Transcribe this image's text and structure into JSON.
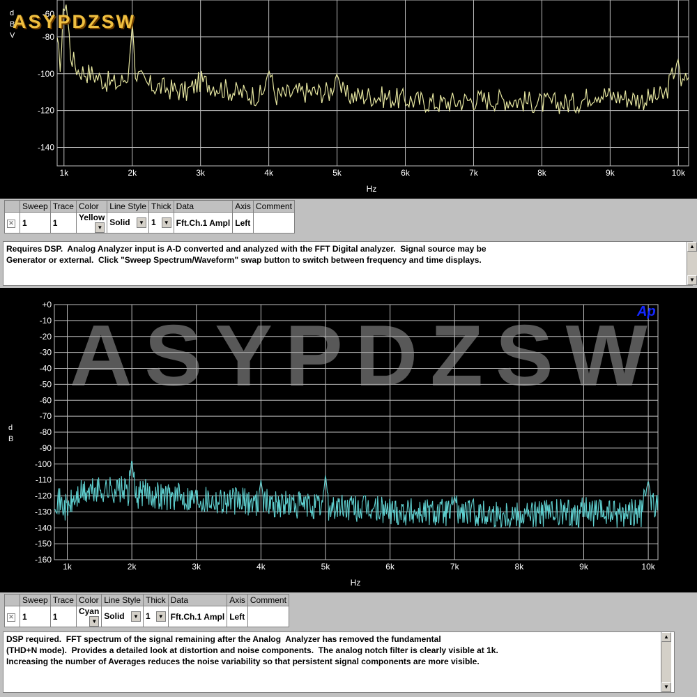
{
  "watermark_logo": "ASYPDZSW",
  "watermark_center": "ASYPDZSW",
  "top_graph": {
    "ylabel": "d\nB\nV",
    "ytick_partial": "-60",
    "yticks": [
      "-80",
      "-100",
      "-120",
      "-140"
    ],
    "xticks": [
      "1k",
      "2k",
      "3k",
      "4k",
      "5k",
      "6k",
      "7k",
      "8k",
      "9k",
      "10k"
    ],
    "xlabel": "Hz",
    "trace_color": "#e6e6a0",
    "background": "#000000",
    "grid_color": "#bfbfbf"
  },
  "top_legend": {
    "headers": [
      "Sweep",
      "Trace",
      "Color",
      "Line Style",
      "Thick",
      "Data",
      "Axis",
      "Comment"
    ],
    "row": {
      "sweep": "1",
      "trace": "1",
      "color": "Yellow",
      "line_style": "Solid",
      "thick": "1",
      "data": "Fft.Ch.1 Ampl",
      "axis": "Left",
      "comment": ""
    }
  },
  "top_description": "Requires DSP.  Analog Analyzer input is A-D converted and analyzed with the FFT Digital analyzer.  Signal source may be\nGenerator or external.  Click \"Sweep Spectrum/Waveform\" swap button to switch between frequency and time displays.",
  "bottom_graph": {
    "ylabel": "d\nB",
    "yticks": [
      "+0",
      "-10",
      "-20",
      "-30",
      "-40",
      "-50",
      "-60",
      "-70",
      "-80",
      "-90",
      "-100",
      "-110",
      "-120",
      "-130",
      "-140",
      "-150",
      "-160"
    ],
    "xticks": [
      "1k",
      "2k",
      "3k",
      "4k",
      "5k",
      "6k",
      "7k",
      "8k",
      "9k",
      "10k"
    ],
    "xlabel": "Hz",
    "ap_logo": "Ap",
    "trace_color": "#5fd0d0",
    "background": "#000000",
    "grid_color": "#bfbfbf"
  },
  "bottom_legend": {
    "headers": [
      "Sweep",
      "Trace",
      "Color",
      "Line Style",
      "Thick",
      "Data",
      "Axis",
      "Comment"
    ],
    "row": {
      "sweep": "1",
      "trace": "1",
      "color": "Cyan",
      "line_style": "Solid",
      "thick": "1",
      "data": "Fft.Ch.1 Ampl",
      "axis": "Left",
      "comment": ""
    }
  },
  "bottom_description": "DSP required.  FFT spectrum of the signal remaining after the Analog  Analyzer has removed the fundamental\n(THD+N mode).  Provides a detailed look at distortion and noise components.  The analog notch filter is clearly visible at 1k.\nIncreasing the number of Averages reduces the noise variability so that persistent signal components are more visible.",
  "chart_data": [
    {
      "type": "line",
      "title": "",
      "xlabel": "Hz",
      "ylabel": "dBV",
      "xlim": [
        900,
        10150
      ],
      "ylim": [
        -150,
        -60
      ],
      "series": [
        {
          "x": [
            900,
            950,
            1000,
            1030,
            1100,
            1200,
            1400,
            1600,
            1800,
            1950,
            2000,
            2050,
            2200,
            2500,
            2800,
            3000,
            3500,
            3900,
            4000,
            4100,
            4500,
            4900,
            5000,
            5100,
            5500,
            6000,
            6500,
            7000,
            7500,
            8000,
            8500,
            8800,
            9000,
            9500,
            9800,
            10000,
            10050,
            10150
          ],
          "y": [
            -85,
            -95,
            -62,
            -60,
            -90,
            -98,
            -100,
            -104,
            -106,
            -100,
            -72,
            -100,
            -106,
            -108,
            -110,
            -104,
            -110,
            -112,
            -98,
            -112,
            -110,
            -110,
            -100,
            -112,
            -112,
            -114,
            -116,
            -114,
            -114,
            -116,
            -116,
            -110,
            -112,
            -114,
            -112,
            -92,
            -108,
            -100
          ]
        }
      ]
    },
    {
      "type": "line",
      "title": "",
      "xlabel": "Hz",
      "ylabel": "dB",
      "xlim": [
        800,
        10150
      ],
      "ylim": [
        -160,
        0
      ],
      "series": [
        {
          "x": [
            800,
            900,
            1000,
            1100,
            1200,
            1400,
            1600,
            1800,
            1950,
            2000,
            2050,
            2200,
            2500,
            3000,
            3500,
            3950,
            4000,
            4050,
            4500,
            4950,
            5000,
            5050,
            5500,
            6000,
            6500,
            6950,
            7000,
            7050,
            7500,
            8000,
            8500,
            8950,
            9000,
            9050,
            9500,
            9800,
            9900,
            10000,
            10050,
            10150
          ],
          "y": [
            -120,
            -125,
            -128,
            -123,
            -119,
            -117,
            -116,
            -116,
            -118,
            -96,
            -120,
            -118,
            -120,
            -121,
            -123,
            -124,
            -110,
            -124,
            -126,
            -127,
            -106,
            -127,
            -128,
            -129,
            -130,
            -130,
            -120,
            -130,
            -131,
            -131,
            -131,
            -131,
            -124,
            -131,
            -131,
            -130,
            -131,
            -110,
            -123,
            -128
          ]
        }
      ]
    }
  ]
}
